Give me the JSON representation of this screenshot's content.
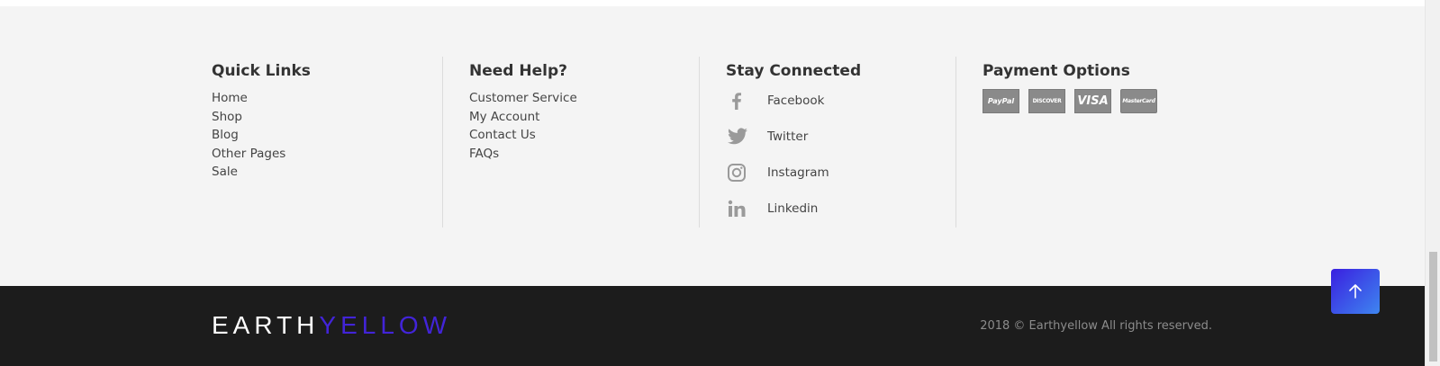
{
  "quick_links": {
    "title": "Quick Links",
    "items": [
      "Home",
      "Shop",
      "Blog",
      "Other Pages",
      "Sale"
    ]
  },
  "need_help": {
    "title": "Need Help?",
    "items": [
      "Customer Service",
      "My Account",
      "Contact Us",
      "FAQs"
    ]
  },
  "stay_connected": {
    "title": "Stay Connected",
    "items": [
      {
        "label": "Facebook",
        "icon": "facebook-icon"
      },
      {
        "label": "Twitter",
        "icon": "twitter-icon"
      },
      {
        "label": "Instagram",
        "icon": "instagram-icon"
      },
      {
        "label": "Linkedin",
        "icon": "linkedin-icon"
      }
    ]
  },
  "payment_options": {
    "title": "Payment Options",
    "cards": [
      "PayPal",
      "DISCOVER",
      "VISA",
      "MasterCard"
    ]
  },
  "footer": {
    "logo_part1": "EARTH",
    "logo_part2": "YELLOW",
    "copyright": "2018 © Earthyellow All rights reserved."
  },
  "colors": {
    "accent": "#4224d8",
    "footer_dark": "#1c1c1c",
    "footer_light": "#f4f4f4"
  }
}
